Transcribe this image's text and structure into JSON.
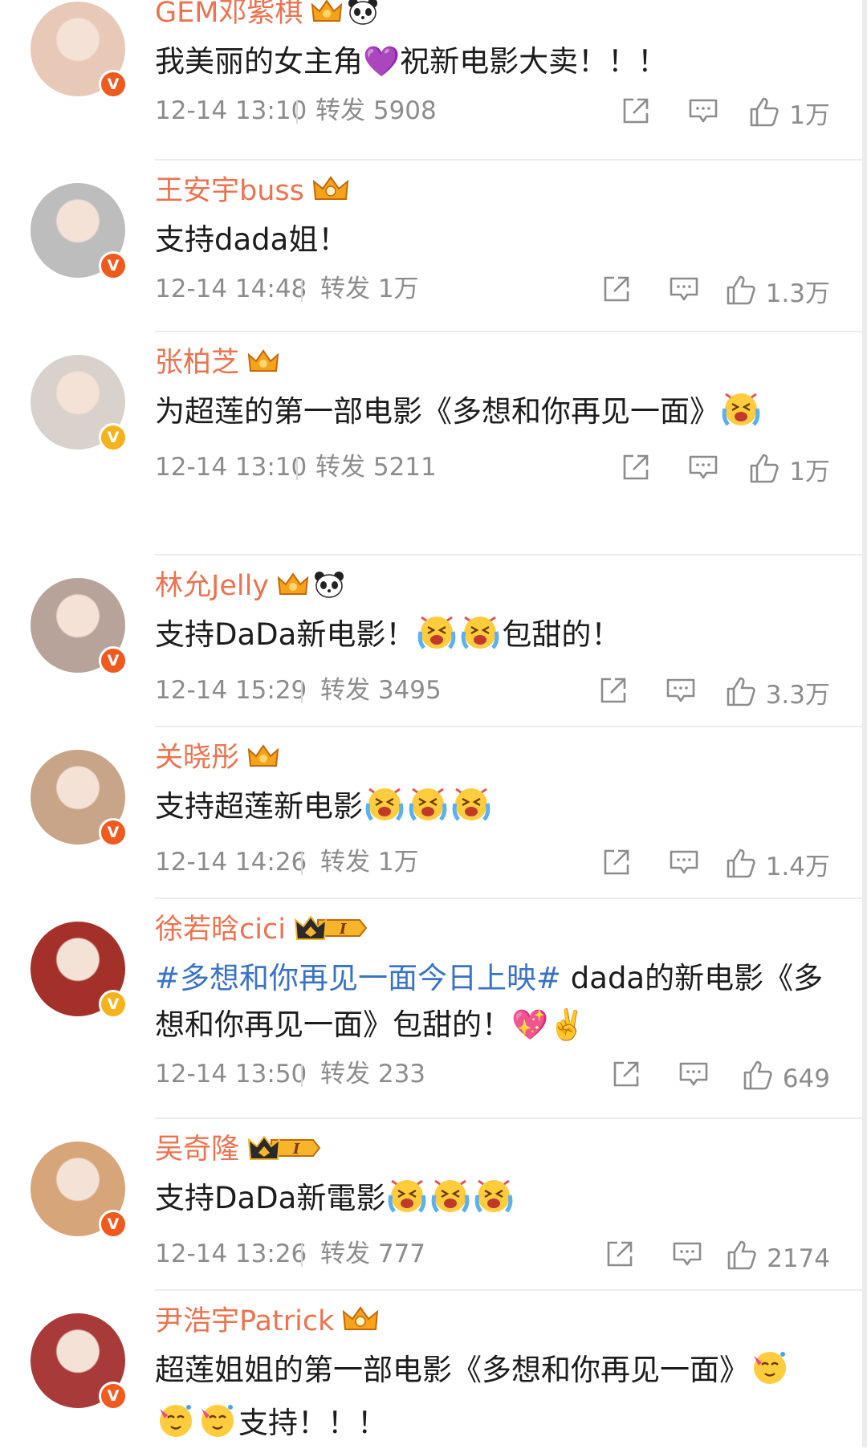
{
  "comments": [
    {
      "name": "GEM邓紫棋",
      "badge": "crown",
      "panda": true,
      "rank": "",
      "verify": "red",
      "avatar_color": "#e8c9b8",
      "text": "我美丽的女主角💜祝新电影大卖！！！",
      "hashtag": "",
      "emotes": [],
      "time": "12-14 13:10",
      "repost": "转发 5908",
      "likes": "1万"
    },
    {
      "name": "王安宇buss",
      "badge": "crown2",
      "panda": false,
      "rank": "",
      "verify": "red",
      "avatar_color": "#bdbdbd",
      "text": "支持dada姐！",
      "hashtag": "",
      "emotes": [],
      "time": "12-14 14:48",
      "repost": "转发 1万",
      "likes": "1.3万"
    },
    {
      "name": "张柏芝",
      "badge": "crown",
      "panda": false,
      "rank": "",
      "verify": "gold",
      "avatar_color": "#d9d2cc",
      "text": "为超莲的第一部电影《多想和你再见一面》",
      "hashtag": "",
      "emotes": [
        "cry"
      ],
      "time": "12-14 13:10",
      "repost": "转发 5211",
      "likes": "1万"
    },
    {
      "name": "林允Jelly",
      "badge": "crown",
      "panda": true,
      "rank": "",
      "verify": "red",
      "avatar_color": "#b7a39a",
      "text": "支持DaDa新电影！",
      "hashtag": "",
      "emotes": [
        "cry",
        "cry"
      ],
      "tail": "包甜的！",
      "time": "12-14 15:29",
      "repost": "转发 3495",
      "likes": "3.3万"
    },
    {
      "name": "关晓彤",
      "badge": "crown",
      "panda": false,
      "rank": "",
      "verify": "red",
      "avatar_color": "#c8a488",
      "text": "支持超莲新电影",
      "hashtag": "",
      "emotes": [
        "cry",
        "cry",
        "cry"
      ],
      "time": "12-14 14:26",
      "repost": "转发 1万",
      "likes": "1.4万"
    },
    {
      "name": "徐若晗cici",
      "badge": "rankcrown",
      "panda": false,
      "rank": "I",
      "verify": "gold",
      "avatar_color": "#a4302a",
      "hashtag": "#多想和你再见一面今日上映#",
      "text": "dada的新电影《多想和你再见一面》包甜的！💖✌️",
      "emotes": [],
      "time": "12-14 13:50",
      "repost": "转发 233",
      "likes": "649"
    },
    {
      "name": "吴奇隆",
      "badge": "rankcrown",
      "panda": false,
      "rank": "I",
      "verify": "red",
      "avatar_color": "#d7a57a",
      "text": "支持DaDa新電影",
      "hashtag": "",
      "emotes": [
        "cry",
        "cry",
        "cry"
      ],
      "time": "12-14 13:26",
      "repost": "转发 777",
      "likes": "2174"
    },
    {
      "name": "尹浩宇Patrick",
      "badge": "crown2",
      "panda": false,
      "rank": "",
      "verify": "red",
      "avatar_color": "#a83a3a",
      "text": "超莲姐姐的第一部电影《多想和你再见一面》",
      "hashtag": "",
      "emotes": [
        "party",
        "party",
        "party"
      ],
      "tail": "支持！！！",
      "time": "",
      "repost": "",
      "likes": ""
    }
  ],
  "colors": {
    "name": "#eb7350",
    "hashtag": "#3b73c4",
    "meta": "#8c8c8c",
    "text": "#1c1c1c"
  }
}
